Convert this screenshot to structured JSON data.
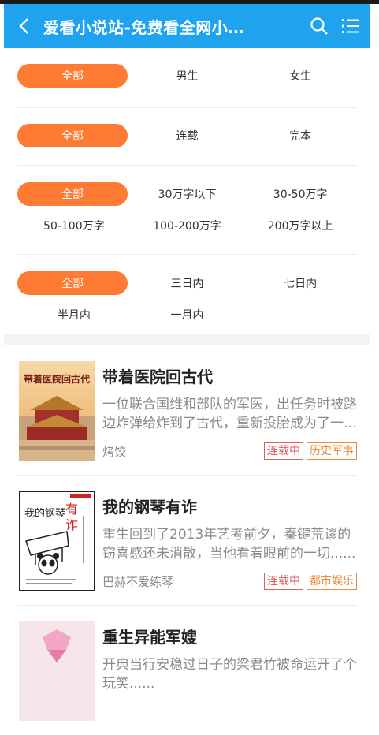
{
  "header": {
    "title": "爱看小说站-免费看全网小说网",
    "colors": {
      "bar": "#1fa3ef",
      "accent": "#ff7a33"
    }
  },
  "filters": [
    {
      "options": [
        "全部",
        "男生",
        "女生"
      ],
      "active": 0
    },
    {
      "options": [
        "连载",
        "完本"
      ],
      "all": "全部",
      "active": 0
    },
    {
      "options": [
        "30万字以下",
        "30-50万字",
        "50-100万字",
        "100-200万字",
        "200万字以上"
      ],
      "all": "全部",
      "active": 0
    },
    {
      "options": [
        "三日内",
        "七日内",
        "半月内",
        "一月内"
      ],
      "all": "全部",
      "active": 0
    }
  ],
  "books": [
    {
      "title": "带着医院回古代",
      "desc": "一位联合国维和部队的军医，出任务时被路边炸弹给炸到了古代，重新投胎成为了一个......",
      "author": "烤饺",
      "status": "连载中",
      "category": "历史军事",
      "cover_title": "带着医院回古代"
    },
    {
      "title": "我的钢琴有诈",
      "desc": "重生回到了2013年艺考前夕，秦键荒谬的窃喜感还未消散，当他看着眼前的一切......",
      "author": "巴赫不爱练琴",
      "status": "连载中",
      "category": "都市娱乐",
      "cover_title_a": "我的钢琴",
      "cover_title_b": "有诈"
    },
    {
      "title": "重生异能军嫂",
      "desc": "开典当行安稳过日子的梁君竹被命运开了个玩笑......",
      "author": "",
      "status": "",
      "category": ""
    }
  ]
}
